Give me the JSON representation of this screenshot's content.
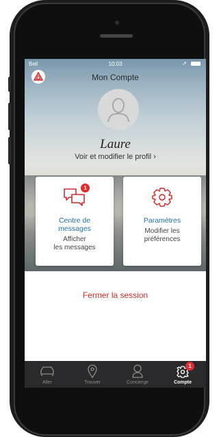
{
  "status_bar": {
    "carrier": "Bell",
    "time": "10:03"
  },
  "header": {
    "title": "Mon Compte"
  },
  "profile": {
    "name": "Laure",
    "link": "Voir et modifier le profil ›"
  },
  "cards": {
    "messages": {
      "title_line1": "Centre de",
      "title_line2": "messages",
      "sub_line1": "Afficher",
      "sub_line2": "les messages",
      "badge": "1"
    },
    "settings": {
      "title": "Paramètres",
      "sub_line1": "Modifier les",
      "sub_line2": "préférences"
    }
  },
  "logout": "Fermer la session",
  "tabbar": {
    "items": [
      {
        "label": "Aller",
        "icon": "car-icon"
      },
      {
        "label": "Trouver",
        "icon": "location-pin-icon"
      },
      {
        "label": "Concierge",
        "icon": "concierge-icon"
      },
      {
        "label": "Compte",
        "icon": "gear-icon",
        "badge": "1",
        "active": true
      }
    ]
  },
  "colors": {
    "accent": "#d12b2b",
    "link": "#1f6f9e",
    "tabbar": "#2a2a2c"
  }
}
